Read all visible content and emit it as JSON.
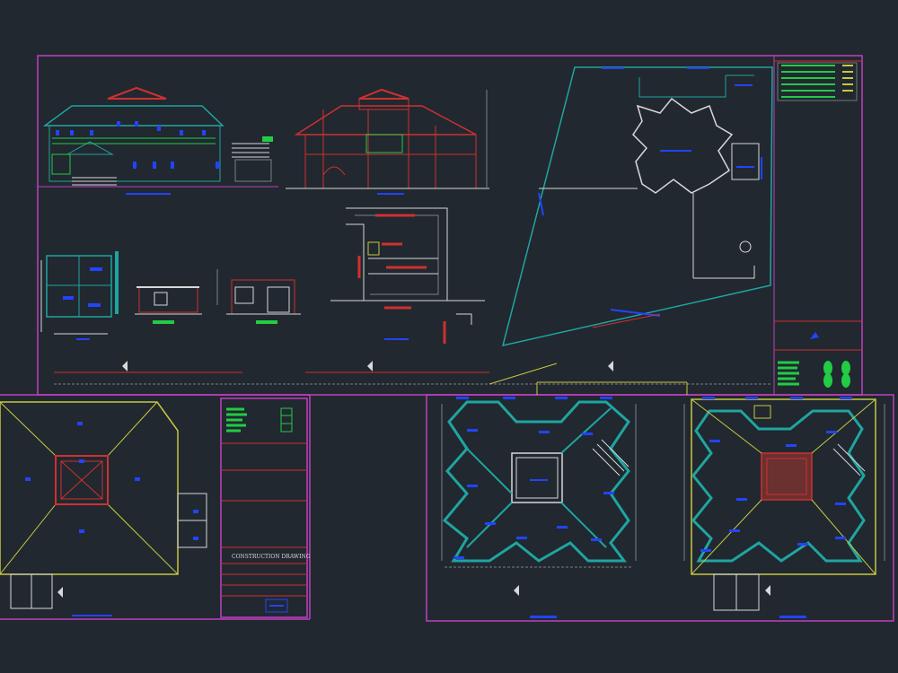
{
  "app": "CAD drawing viewer",
  "drawing": {
    "background": "#212830",
    "colors": {
      "frame_magenta": "#c040c0",
      "wall_cyan": "#1fa5a0",
      "label_blue": "#2244ff",
      "label_red": "#d03030",
      "label_green": "#22cc44",
      "line_white": "#d8d8d8",
      "line_yellow": "#c8c840",
      "line_grey": "#7a8088"
    },
    "title_block_lower": {
      "title": "CONSTRUCTION  DRAWING"
    }
  }
}
